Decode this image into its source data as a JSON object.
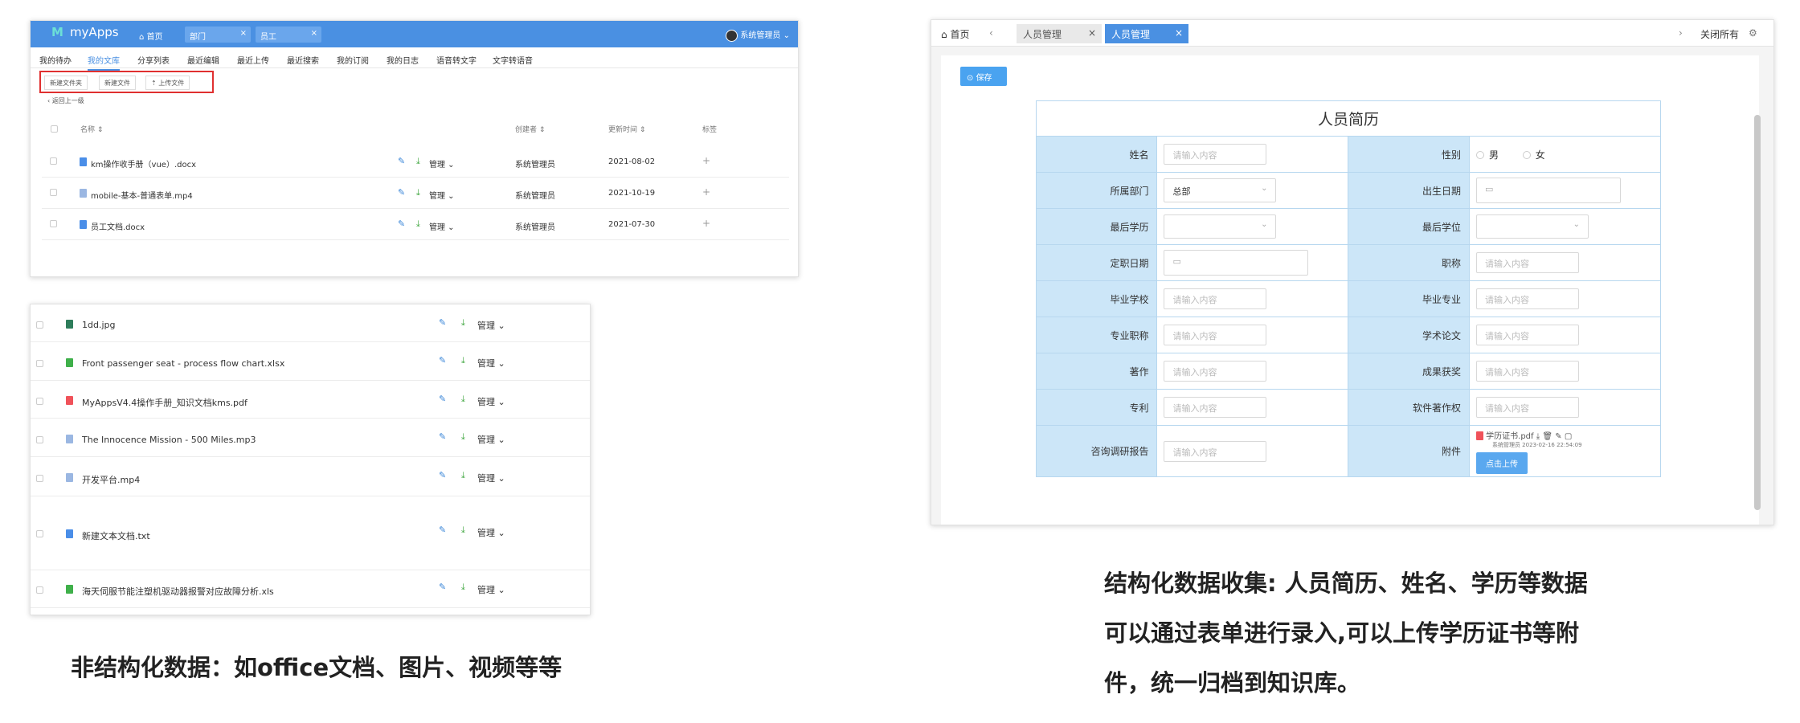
{
  "panel1": {
    "logo_mark": "M",
    "app_name": "myApps",
    "home_tab": "首页",
    "top_tabs": [
      "部门",
      "员工"
    ],
    "user_name": "系统管理员",
    "subnav": [
      "我的待办",
      "我的文库",
      "分享列表",
      "最近编辑",
      "最近上传",
      "最近搜索",
      "我的订阅",
      "我的日志",
      "语音转文字",
      "文字转语音"
    ],
    "toolbar": {
      "new_folder": "新建文件夹",
      "new_file": "新建文件",
      "upload": "上传文件"
    },
    "back_label": "返回上一级",
    "columns": {
      "name": "名称",
      "creator": "创建者",
      "updated": "更新时间",
      "tags": "标签"
    },
    "manage_label": "管理",
    "rows": [
      {
        "name": "km操作收手册（vue）.docx",
        "creator": "系统管理员",
        "updated": "2021-08-02"
      },
      {
        "name": "mobile-基本-普通表单.mp4",
        "creator": "系统管理员",
        "updated": "2021-10-19"
      },
      {
        "name": "员工文档.docx",
        "creator": "系统管理员",
        "updated": "2021-07-30"
      }
    ]
  },
  "panel2": {
    "manage_label": "管理",
    "files": [
      {
        "name": "1dd.jpg",
        "color": "#2e7d5b"
      },
      {
        "name": "Front passenger seat - process flow chart.xlsx",
        "color": "#3fb04a"
      },
      {
        "name": "MyAppsV4.4操作手册_知识文档kms.pdf",
        "color": "#f0525a"
      },
      {
        "name": "The Innocence Mission - 500 Miles.mp3",
        "color": "#9bb7e2"
      },
      {
        "name": "开发平台.mp4",
        "color": "#9bb7e2"
      },
      {
        "name": "新建文本文档.txt",
        "color": "#4a8ee8"
      },
      {
        "name": "海天伺服节能注塑机驱动器报警对应故障分析.xls",
        "color": "#3fb04a"
      }
    ]
  },
  "caption_left": "非结构化数据：如office文档、图片、视频等等",
  "panel3": {
    "home_label": "首页",
    "tabs": [
      "人员管理",
      "人员管理"
    ],
    "close_all": "关闭所有",
    "save_label": "保存",
    "form_title": "人员简历",
    "placeholder": "请输入内容",
    "labels": {
      "name": "姓名",
      "gender": "性别",
      "dept": "所属部门",
      "birth": "出生日期",
      "edu": "最后学历",
      "degree": "最后学位",
      "title_date": "定职日期",
      "title": "职称",
      "school": "毕业学校",
      "major": "毕业专业",
      "pro_title": "专业职称",
      "paper": "学术论文",
      "works": "著作",
      "award": "成果获奖",
      "patent": "专利",
      "software": "软件著作权",
      "report": "咨询调研报告",
      "attach": "附件"
    },
    "gender_options": [
      "男",
      "女"
    ],
    "dept_value": "总部",
    "attachment": {
      "file": "学历证书.pdf",
      "meta": "系统管理员 2023-02-16 22:54:09",
      "upload_label": "点击上传"
    }
  },
  "caption_right": [
    "结构化数据收集: 人员简历、姓名、学历等数据",
    "可以通过表单进行录入,可以上传学历证书等附",
    "件，统一归档到知识库。"
  ]
}
